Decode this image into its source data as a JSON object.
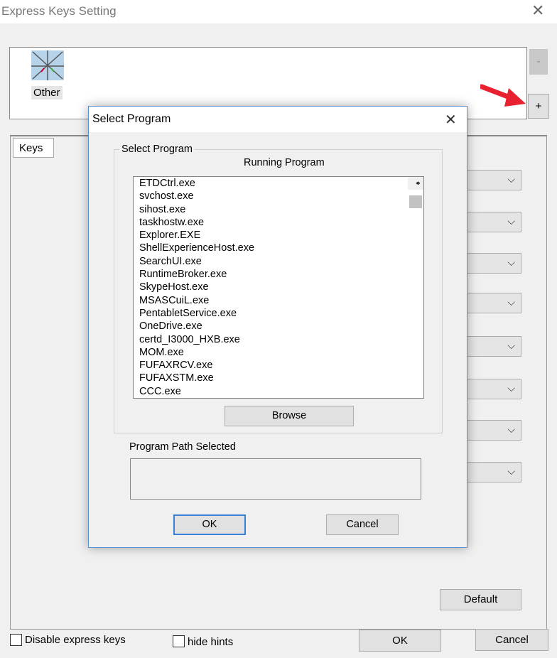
{
  "window": {
    "title": "Express Keys Setting",
    "close": "✕"
  },
  "programs": {
    "other_label": "Other",
    "remove_label": "-",
    "add_label": "+"
  },
  "tabs": {
    "keys": "Keys"
  },
  "combo_chevron": "⌵",
  "default_label": "Default",
  "footer": {
    "disable_label": "Disable express keys",
    "hints_label": "hide hints",
    "ok": "OK",
    "cancel": "Cancel"
  },
  "dialog": {
    "title": "Select Program",
    "close": "✕",
    "group_label": "Select Program",
    "running_label": "Running Program",
    "programs": [
      "ETDCtrl.exe",
      "svchost.exe",
      "sihost.exe",
      "taskhostw.exe",
      "Explorer.EXE",
      "ShellExperienceHost.exe",
      "SearchUI.exe",
      "RuntimeBroker.exe",
      "SkypeHost.exe",
      "MSASCuiL.exe",
      "PentabletService.exe",
      "OneDrive.exe",
      "certd_I3000_HXB.exe",
      "MOM.exe",
      "FUFAXRCV.exe",
      "FUFAXSTM.exe",
      "CCC.exe"
    ],
    "browse": "Browse",
    "path_label": "Program Path Selected",
    "path_value": "",
    "ok": "OK",
    "cancel": "Cancel"
  },
  "colors": {
    "accent": "#5b8fcf",
    "arrow": "#e8202f"
  }
}
